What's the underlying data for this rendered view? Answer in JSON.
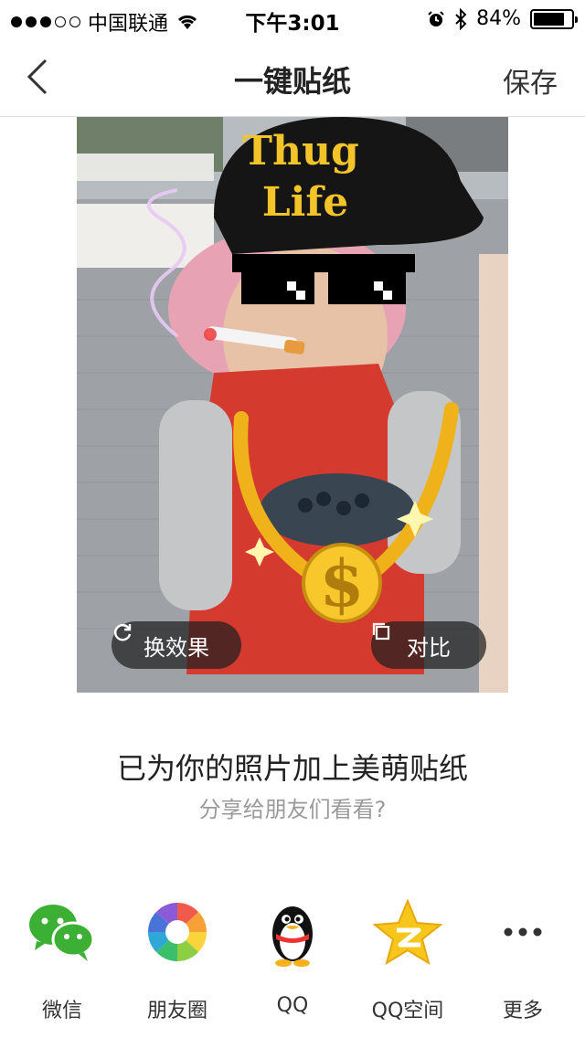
{
  "status_bar": {
    "carrier": "中国联通",
    "time": "下午3:01",
    "battery": "84%",
    "battery_level": 0.84,
    "signal_bars": 3
  },
  "nav": {
    "title": "一键贴纸",
    "save_label": "保存"
  },
  "photo": {
    "hat_text_line1": "Thug",
    "hat_text_line2": "Life",
    "change_effect_label": "换效果",
    "compare_label": "对比"
  },
  "message": {
    "headline": "已为你的照片加上美萌贴纸",
    "subline": "分享给朋友们看看?"
  },
  "share": {
    "items": [
      {
        "label": "微信",
        "icon": "wechat-icon"
      },
      {
        "label": "朋友圈",
        "icon": "moments-icon"
      },
      {
        "label": "QQ",
        "icon": "qq-penguin-icon"
      },
      {
        "label": "QQ空间",
        "icon": "qzone-star-icon"
      },
      {
        "label": "更多",
        "icon": "more-dots-icon"
      }
    ]
  }
}
